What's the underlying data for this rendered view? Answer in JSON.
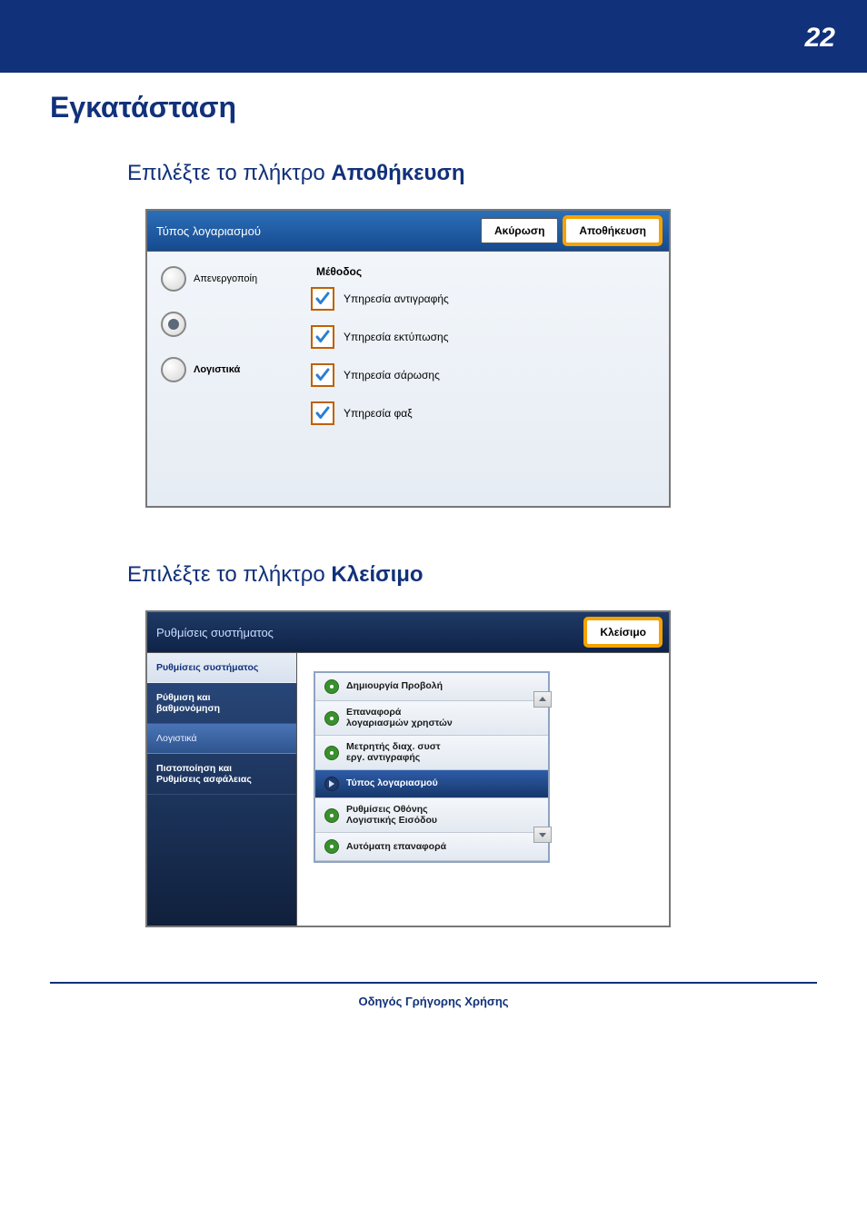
{
  "page_number": "22",
  "h1": "Εγκατάσταση",
  "step1_prefix": "Επιλέξτε το πλήκτρο ",
  "step1_bold": "Αποθήκευση",
  "step2_prefix": "Επιλέξτε το πλήκτρο ",
  "step2_bold": "Κλείσιμο",
  "footer": "Οδηγός Γρήγορης Χρήσης",
  "panel1": {
    "title": "Τύπος λογαριασμού",
    "cancel": "Ακύρωση",
    "save": "Αποθήκευση",
    "radios": [
      {
        "label": "Απενεργοποίη",
        "bold": false,
        "sel": false
      },
      {
        "label": "",
        "bold": false,
        "sel": true
      },
      {
        "label": "Λογιστικά",
        "bold": true,
        "sel": false
      }
    ],
    "method_title": "Μέθοδος",
    "checks": [
      "Υπηρεσία αντιγραφής",
      "Υπηρεσία εκτύπωσης",
      "Υπηρεσία σάρωσης",
      "Υπηρεσία φαξ"
    ]
  },
  "panel2": {
    "title": "Ρυθμίσεις συστήματος",
    "close": "Κλείσιμο",
    "sidebar": [
      {
        "text": "Ρυθμίσεις συστήματος",
        "type": "header"
      },
      {
        "text": "Ρύθμιση και\nβαθμονόμηση",
        "type": "item"
      },
      {
        "text": "Λογιστικά",
        "type": "active"
      },
      {
        "text": "Πιστοποίηση και\nΡυθμίσεις ασφάλειας",
        "type": "item"
      }
    ],
    "list": [
      {
        "text": "Δημιουργία Προβολή",
        "sel": false
      },
      {
        "text": "Επαναφορά\nλογαριασμών χρηστών",
        "sel": false
      },
      {
        "text": "Μετρητής διαχ. συστ\nεργ. αντιγραφής",
        "sel": false
      },
      {
        "text": "Τύπος λογαριασμού",
        "sel": true
      },
      {
        "text": "Ρυθμίσεις Οθόνης\nΛογιστικής Εισόδου",
        "sel": false
      },
      {
        "text": "Αυτόματη επαναφορά",
        "sel": false
      }
    ]
  }
}
